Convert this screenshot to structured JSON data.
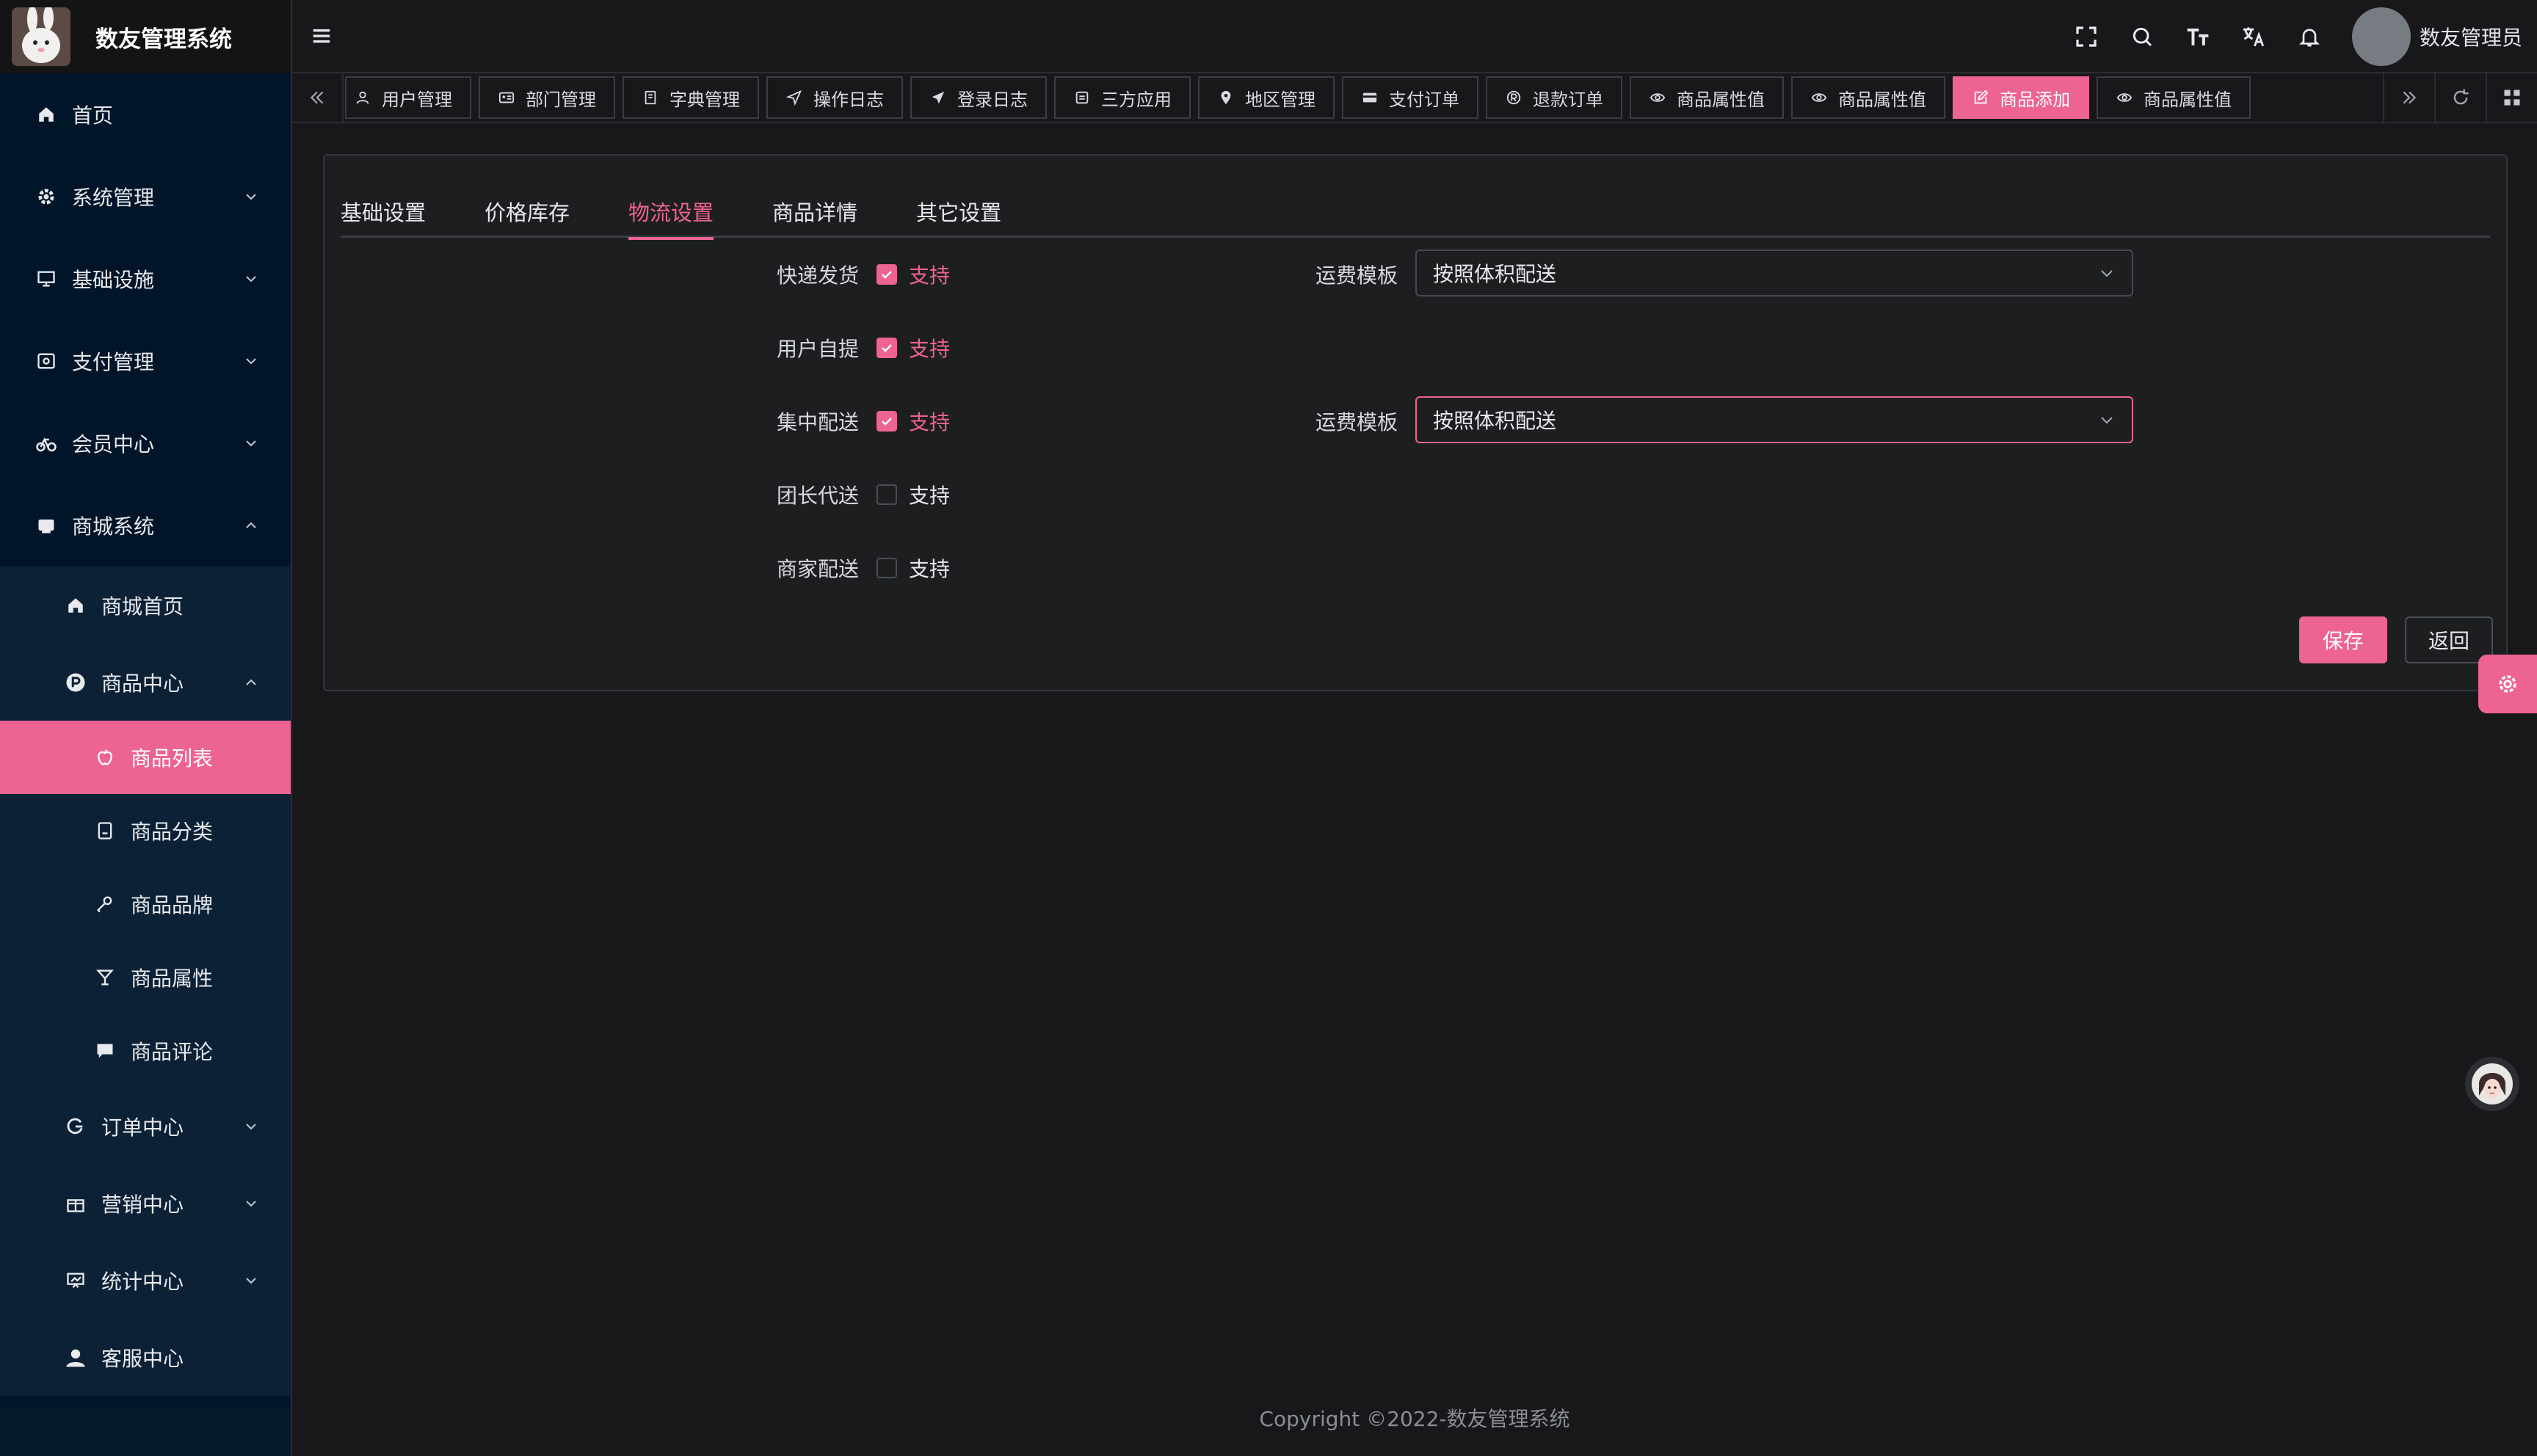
{
  "app": {
    "name": "数友管理系统"
  },
  "sidebar": {
    "items": [
      {
        "label": "首页",
        "icon": "home-icon"
      },
      {
        "label": "系统管理",
        "icon": "gear-icon"
      },
      {
        "label": "基础设施",
        "icon": "monitor-icon"
      },
      {
        "label": "支付管理",
        "icon": "payment-icon"
      },
      {
        "label": "会员中心",
        "icon": "bike-icon"
      },
      {
        "label": "商城系统",
        "icon": "shop-icon"
      }
    ],
    "mall_children": [
      {
        "label": "商城首页",
        "icon": "home-icon"
      },
      {
        "label": "商品中心",
        "icon": "p-circle-icon"
      }
    ],
    "goods_children": [
      {
        "label": "商品列表",
        "icon": "apple-icon"
      },
      {
        "label": "商品分类",
        "icon": "category-icon"
      },
      {
        "label": "商品品牌",
        "icon": "brand-icon"
      },
      {
        "label": "商品属性",
        "icon": "attr-icon"
      },
      {
        "label": "商品评论",
        "icon": "comment-icon"
      }
    ],
    "more": [
      {
        "label": "订单中心",
        "icon": "order-icon"
      },
      {
        "label": "营销中心",
        "icon": "gift-icon"
      },
      {
        "label": "统计中心",
        "icon": "chart-icon"
      },
      {
        "label": "客服中心",
        "icon": "user-icon"
      }
    ]
  },
  "header": {
    "user_name": "数友管理员"
  },
  "tabs": [
    {
      "label": "用户管理",
      "icon": "user-icon"
    },
    {
      "label": "部门管理",
      "icon": "idcard-icon"
    },
    {
      "label": "字典管理",
      "icon": "book-icon"
    },
    {
      "label": "操作日志",
      "icon": "send-icon"
    },
    {
      "label": "登录日志",
      "icon": "plane-icon"
    },
    {
      "label": "三方应用",
      "icon": "app-icon"
    },
    {
      "label": "地区管理",
      "icon": "location-icon"
    },
    {
      "label": "支付订单",
      "icon": "card-icon"
    },
    {
      "label": "退款订单",
      "icon": "refund-icon"
    },
    {
      "label": "商品属性值",
      "icon": "eye-icon"
    },
    {
      "label": "商品属性值",
      "icon": "eye-icon"
    },
    {
      "label": "商品添加",
      "icon": "edit-icon",
      "active": true
    },
    {
      "label": "商品属性值",
      "icon": "eye-icon"
    }
  ],
  "page_tabs": [
    "基础设置",
    "价格库存",
    "物流设置",
    "商品详情",
    "其它设置"
  ],
  "active_page_tab": "物流设置",
  "logistics": {
    "rows": [
      {
        "label": "快递发货",
        "checked": true,
        "text": "支持"
      },
      {
        "label": "用户自提",
        "checked": true,
        "text": "支持"
      },
      {
        "label": "集中配送",
        "checked": true,
        "text": "支持"
      },
      {
        "label": "团长代送",
        "checked": false,
        "text": "支持"
      },
      {
        "label": "商家配送",
        "checked": false,
        "text": "支持"
      }
    ],
    "template_label": "运费模板",
    "template_1": "按照体积配送",
    "template_2": "按照体积配送"
  },
  "buttons": {
    "save": "保存",
    "back": "返回"
  },
  "footer": {
    "text": "Copyright ©2022-数友管理系统"
  },
  "colors": {
    "accent": "#ed6391",
    "sidebar_bg": "#001529",
    "page_bg": "#18181a"
  }
}
